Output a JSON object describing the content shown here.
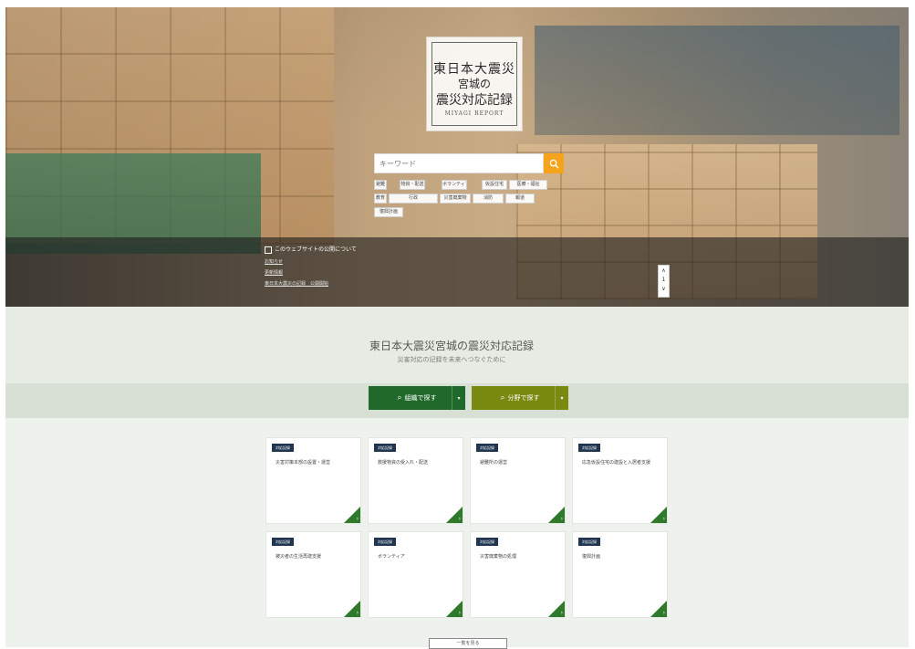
{
  "hero": {
    "logo": {
      "line1": "東日本大震災",
      "line2": "宮城の",
      "line3": "震災対応記録",
      "subtitle": "MIYAGI REPORT"
    },
    "search": {
      "placeholder": "キーワード"
    },
    "tags": [
      "避難",
      "物資・配送",
      "ボランティア",
      "仮設住宅",
      "医療・福祉",
      "教育",
      "行政",
      "災害廃棄物",
      "消防",
      "報道",
      "復興計画"
    ],
    "news": {
      "title": "このウェブサイトの公開について",
      "items": [
        "お知らせ",
        "更新情報",
        "東日本大震災の記録　公開開始"
      ]
    },
    "pager": [
      "∧",
      "1",
      "∨"
    ]
  },
  "intro": {
    "title": "東日本大震災宮城の震災対応記録",
    "subtitle": "災害対応の記録を未来へつなぐために"
  },
  "nav": {
    "btn1": "組織で探す",
    "btn2": "分野で探す",
    "colors": {
      "btn1": "#1f6a2a",
      "btn2": "#7a8a10"
    }
  },
  "cards": [
    {
      "badge": "対応記録",
      "text": "災害対策本部の設置・運営"
    },
    {
      "badge": "対応記録",
      "text": "救援物資の受入れ・配送"
    },
    {
      "badge": "対応記録",
      "text": "避難所の運営"
    },
    {
      "badge": "対応記録",
      "text": "応急仮設住宅の建設と入居者支援"
    },
    {
      "badge": "対応記録",
      "text": "被災者の生活再建支援"
    },
    {
      "badge": "対応記録",
      "text": "ボランティア"
    },
    {
      "badge": "対応記録",
      "text": "災害廃棄物の処理"
    },
    {
      "badge": "対応記録",
      "text": "復興計画"
    }
  ],
  "more": {
    "label": "一覧を見る"
  }
}
